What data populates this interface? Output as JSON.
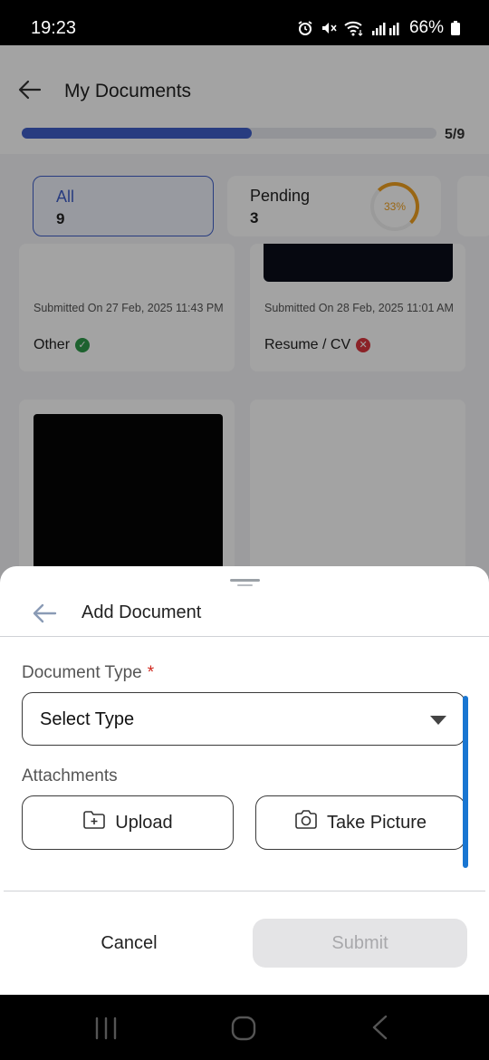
{
  "status_bar": {
    "time": "19:23",
    "battery": "66%"
  },
  "background_screen": {
    "title": "My Documents",
    "progress": {
      "text": "5/9",
      "fraction": 0.5556
    },
    "filters": [
      {
        "label": "All",
        "count": "9"
      },
      {
        "label": "Pending",
        "count": "3",
        "percent": "33%"
      }
    ],
    "documents": [
      {
        "submitted": "Submitted On 27 Feb, 2025 11:43 PM",
        "type": "Other",
        "status": "approved"
      },
      {
        "submitted": "Submitted On 28 Feb, 2025 11:01 AM",
        "type": "Resume / CV",
        "status": "rejected"
      }
    ]
  },
  "sheet": {
    "title": "Add Document",
    "document_type_label": "Document Type",
    "required_mark": "*",
    "select_value": "Select Type",
    "attachments_label": "Attachments",
    "upload_label": "Upload",
    "take_picture_label": "Take Picture",
    "cancel_label": "Cancel",
    "submit_label": "Submit"
  },
  "colors": {
    "accent": "#3f5fc8",
    "scrollbar": "#1976d2",
    "required": "#d0281e",
    "pending_ring": "#f0a020",
    "approved": "#2e9a4a",
    "rejected": "#d9363e"
  },
  "icons": [
    "alarm-icon",
    "mute-icon",
    "wifi-icon",
    "signal-icon",
    "battery-icon",
    "back-arrow-icon",
    "folder-plus-icon",
    "camera-icon",
    "check-circle-icon",
    "x-circle-icon",
    "recent-apps-icon",
    "home-icon",
    "nav-back-icon"
  ]
}
